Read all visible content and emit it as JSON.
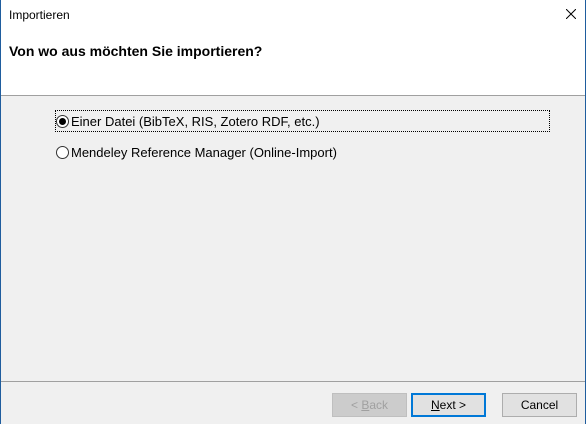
{
  "window": {
    "title": "Importieren"
  },
  "header": {
    "heading": "Von wo aus möchten Sie importieren?"
  },
  "options": [
    {
      "label": "Einer Datei (BibTeX, RIS, Zotero RDF, etc.)",
      "checked": true
    },
    {
      "label": "Mendeley Reference Manager (Online-Import)",
      "checked": false
    }
  ],
  "buttons": {
    "back": {
      "prefix": "< ",
      "accel": "B",
      "rest": "ack",
      "disabled": true
    },
    "next": {
      "accel": "N",
      "rest": "ext >"
    },
    "cancel": "Cancel"
  },
  "icons": {
    "close": "close-icon"
  }
}
